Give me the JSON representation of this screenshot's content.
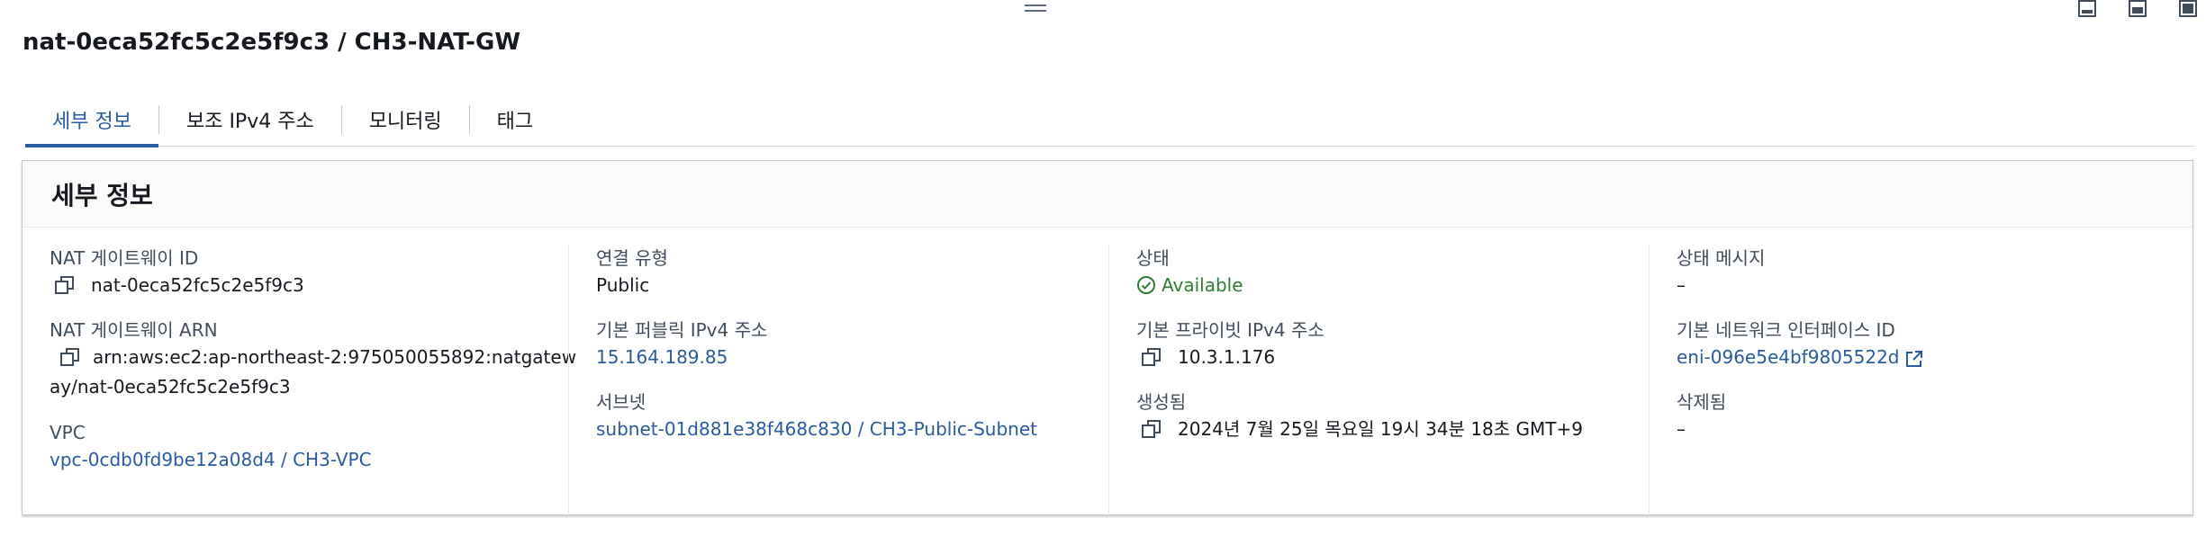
{
  "page": {
    "title": "nat-0eca52fc5c2e5f9c3 / CH3-NAT-GW"
  },
  "tabs": [
    {
      "label": "세부 정보",
      "active": true
    },
    {
      "label": "보조 IPv4 주소",
      "active": false
    },
    {
      "label": "모니터링",
      "active": false
    },
    {
      "label": "태그",
      "active": false
    }
  ],
  "panel": {
    "title": "세부 정보"
  },
  "fields": {
    "nat_id": {
      "label": "NAT 게이트웨이 ID",
      "value": "nat-0eca52fc5c2e5f9c3"
    },
    "nat_arn": {
      "label": "NAT 게이트웨이 ARN",
      "value": "arn:aws:ec2:ap-northeast-2:975050055892:natgateway/nat-0eca52fc5c2e5f9c3"
    },
    "vpc": {
      "label": "VPC",
      "value": "vpc-0cdb0fd9be12a08d4 / CH3-VPC"
    },
    "connectivity": {
      "label": "연결 유형",
      "value": "Public"
    },
    "public_ip": {
      "label": "기본 퍼블릭 IPv4 주소",
      "value": "15.164.189.85"
    },
    "subnet": {
      "label": "서브넷",
      "value": "subnet-01d881e38f468c830 / CH3-Public-Subnet"
    },
    "state": {
      "label": "상태",
      "value": "Available"
    },
    "private_ip": {
      "label": "기본 프라이빗 IPv4 주소",
      "value": "10.3.1.176"
    },
    "created": {
      "label": "생성됨",
      "value": "2024년 7월 25일 목요일 19시 34분 18초 GMT+9"
    },
    "state_message": {
      "label": "상태 메시지",
      "value": "–"
    },
    "eni": {
      "label": "기본 네트워크 인터페이스 ID",
      "value": "eni-096e5e4bf9805522d"
    },
    "deleted": {
      "label": "삭제됨",
      "value": "–"
    }
  },
  "icons": {
    "copy": "copy-icon",
    "status": "check-circle-icon",
    "external": "external-link-icon"
  },
  "colors": {
    "link": "#2a5b9e",
    "success": "#2e7d32",
    "tab_active": "#2a5b9e"
  }
}
